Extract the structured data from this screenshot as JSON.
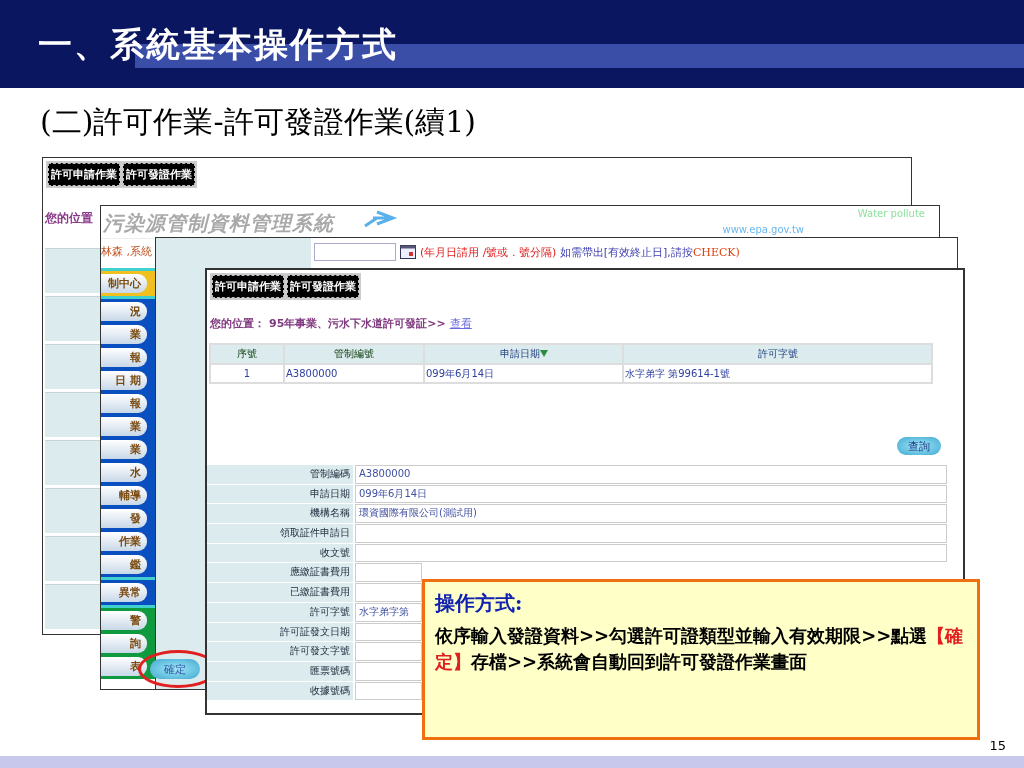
{
  "slide": {
    "title": "一、系統基本操作方式",
    "subtitle": "(二)許可作業-許可發證作業(續1)",
    "page_number": "15"
  },
  "screen_1": {
    "tabs": [
      "許可申請作業",
      "許可發證作業"
    ],
    "location_label": "您的位置"
  },
  "screen_2": {
    "logo_text": "污染源管制資料管理系統",
    "tagline": "Water pollute",
    "site_url": "www.epa.gov.tw",
    "user_text": "林森 ,系統",
    "menu_groups": [
      {
        "color": "#f0c020",
        "items": [
          "制中心"
        ]
      },
      {
        "color": "#0a4fc0",
        "items": [
          "況",
          "業",
          "報",
          "日 期",
          "報",
          "業",
          "業",
          "水",
          "輔導",
          "發",
          "作業",
          "鑑"
        ]
      },
      {
        "color": "#0a4fc0",
        "items": [
          "異常"
        ]
      },
      {
        "color": "#109a40",
        "items": [
          "警",
          "詢",
          "表"
        ]
      }
    ]
  },
  "screen_3": {
    "hint": "(年月日請用 /號或 . 號分隔)",
    "hint_note": "如需帶出[有效終止日],請按",
    "hint_key": "CHECK)",
    "confirm_button": "確定"
  },
  "screen_4": {
    "tabs": [
      "許可申請作業",
      "許可發證作業"
    ],
    "breadcrumb": {
      "label": "您的位置：",
      "path": "95年事業、污水下水道許可發証>>",
      "link": "查看"
    },
    "table": {
      "columns": [
        "序號",
        "管制編號",
        "申請日期",
        "許可字號"
      ],
      "rows": [
        [
          "1",
          "A3800000",
          "099年6月14日",
          "水字弟字 第99614-1號"
        ]
      ]
    },
    "query_button": "查詢",
    "form": [
      {
        "label": "管制編碼",
        "value": "A3800000"
      },
      {
        "label": "申請日期",
        "value": "099年6月14日"
      },
      {
        "label": "機構名稱",
        "value": "環資國際有限公司(測試用)"
      },
      {
        "label": "領取証件申請日"
      },
      {
        "label": "收文號"
      },
      {
        "label": "應繳証書費用"
      },
      {
        "label": "已繳証書費用"
      },
      {
        "label": "許可字號",
        "value": "水字弟字第"
      },
      {
        "label": "許可証發文日期"
      },
      {
        "label": "許可發文字號"
      },
      {
        "label": "匯票號碼"
      },
      {
        "label": "收據號碼"
      }
    ]
  },
  "note": {
    "heading": "操作方式:",
    "body_before": "依序輸入發證資料>>勾選許可證類型並輸入有效期限>>點選",
    "highlight": "【確定】",
    "body_after": "存檔>>系統會自動回到許可發證作業畫面"
  }
}
